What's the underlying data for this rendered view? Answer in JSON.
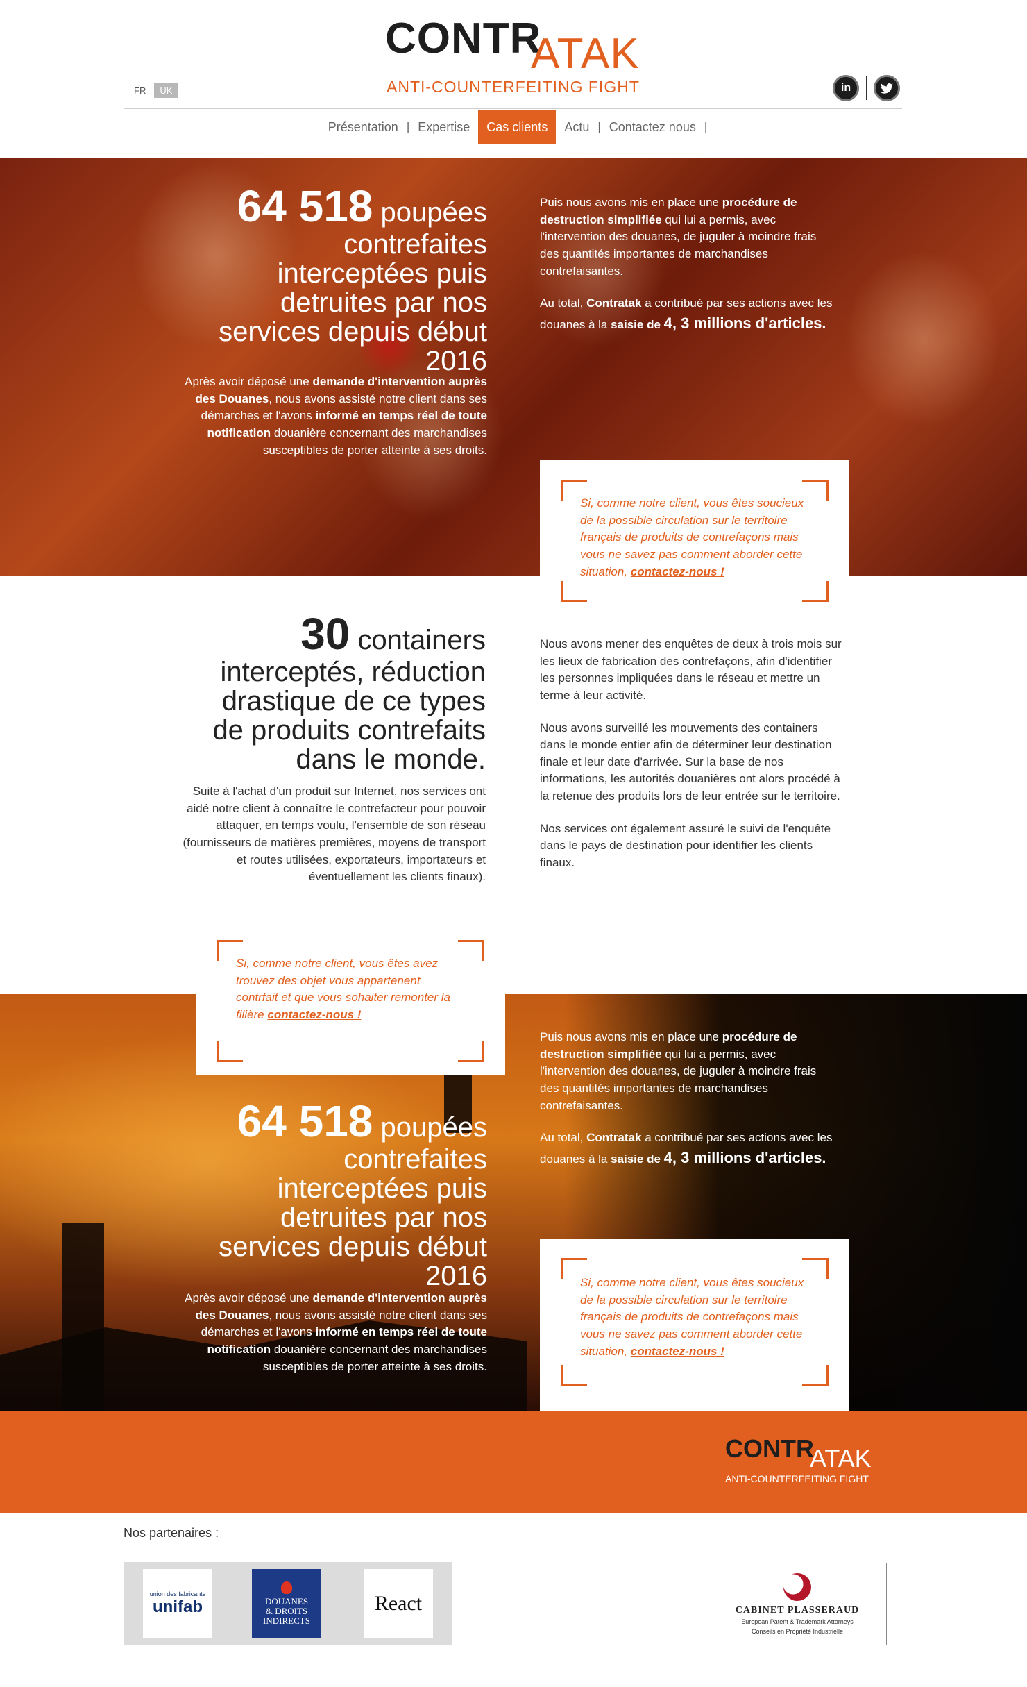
{
  "brand": {
    "logo_left": "CONTR",
    "logo_right": "ATAK",
    "tagline": "ANTI-COUNTERFEITING FIGHT"
  },
  "lang": [
    "FR",
    "UK"
  ],
  "social": {
    "linkedin": "in",
    "twitter": "t"
  },
  "nav": [
    "Présentation",
    "Expertise",
    "Cas clients",
    "Actu",
    "Contactez nous"
  ],
  "nav_separator": "|",
  "case1": {
    "title_num": "64 518",
    "title_l1": "poupées",
    "title_l2": "contrefaites",
    "title_l3": "interceptées puis",
    "title_l4": "detruites par nos",
    "title_l5": "services  depuis début",
    "title_l6": "2016",
    "left_p": {
      "a": "Après avoir déposé une ",
      "b": "demande d'intervention auprès des Douanes",
      "c": ", nous avons assisté notre client dans ses démarches et l'avons ",
      "d": "informé en temps réel de toute notification",
      "e": " douanière concernant des marchandises susceptibles de porter atteinte à ses droits."
    },
    "right_p1": {
      "a": "Puis nous avons mis en place une ",
      "b": "procédure de destruction simplifiée",
      "c": " qui lui a permis, avec l'intervention des douanes, de juguler à moindre frais des quantités importantes de marchandises contrefaisantes."
    },
    "right_p2": {
      "a": "Au total, ",
      "b": "Contratak",
      "c": " a contribué par ses actions avec les douanes à la ",
      "d": "saisie de",
      "e": "4, 3 millions d'articles."
    },
    "quote": "Si, comme notre client, vous êtes soucieux de la possible circulation sur le territoire français de produits de contrefaçons mais vous ne savez pas comment aborder cette situation, ",
    "quote_link": "contactez-nous !"
  },
  "case2": {
    "title_num": "30",
    "title_l1": "containers",
    "title_l2": "interceptés, réduction",
    "title_l3": "drastique de ce types",
    "title_l4": "de produits contrefaits",
    "title_l5": "dans le monde.",
    "left_p": "Suite à l'achat d'un produit sur Internet, nos services ont aidé notre client à connaître le contrefacteur pour pouvoir attaquer, en temps voulu, l'ensemble de son réseau (fournisseurs de matières premières, moyens de transport et routes utilisées, exportateurs, importateurs et éventuellement les clients finaux).",
    "right_p1": "Nous avons mener des enquêtes de deux à trois mois sur les lieux de fabrication des contrefaçons, afin d'identifier les personnes impliquées dans le réseau et mettre un terme à leur activité.",
    "right_p2": "Nous avons surveillé les mouvements des containers dans le monde entier afin de déterminer leur destination finale et leur date d'arrivée. Sur la base de nos informations, les autorités douanières ont alors procédé à la retenue des produits lors de leur entrée sur le territoire.",
    "right_p3": "Nos services ont également assuré le suivi de l'enquête dans le pays de destination pour identifier les clients finaux.",
    "quote": "Si, comme notre client, vous êtes avez trouvez des objet vous appartenent contrfait et que vous sohaiter remonter la filière ",
    "quote_link": "contactez-nous !"
  },
  "footer": {
    "partners_label": "Nos partenaires :",
    "unifab_small": "union des fabricants",
    "unifab": "unifab",
    "douanes": [
      "DOUANES",
      "& DROITS",
      "INDIRECTS"
    ],
    "react": "React",
    "plasseraud": "CABINET PLASSERAUD",
    "plasseraud_sub1": "European Patent & Trademark Attorneys",
    "plasseraud_sub2": "Conseils en Propriété Industrielle"
  },
  "colors": {
    "accent": "#e2601f",
    "dark": "#1e1e1e"
  }
}
